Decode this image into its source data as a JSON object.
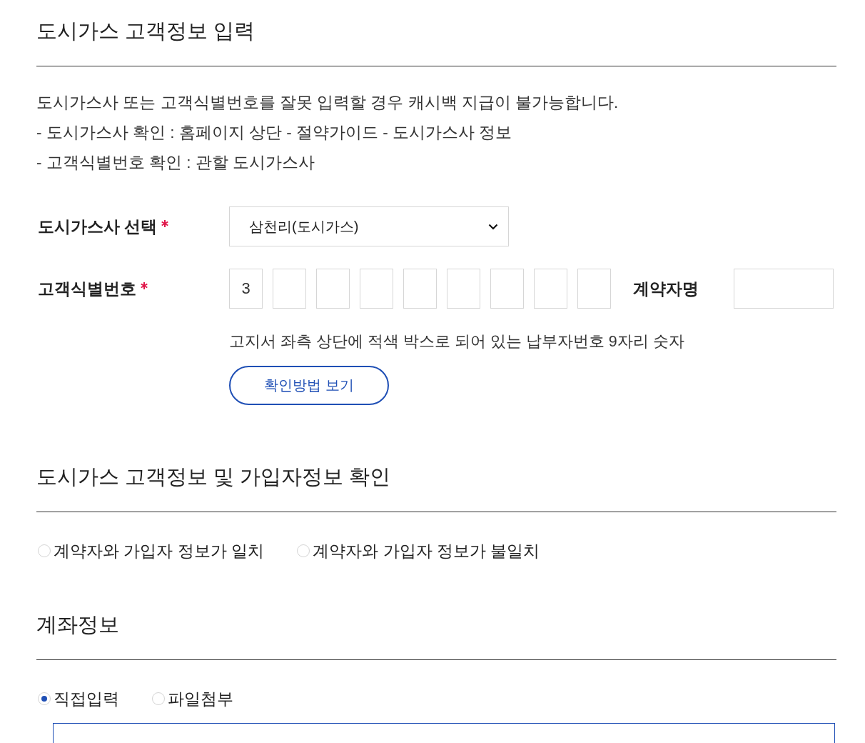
{
  "customer_info": {
    "title": "도시가스 고객정보 입력",
    "notice": [
      "도시가스사 또는 고객식별번호를 잘못 입력할 경우 캐시백 지급이 불가능합니다.",
      "- 도시가스사 확인 : 홈페이지 상단 - 절약가이드 - 도시가스사 정보",
      "- 고객식별번호 확인 : 관할 도시가스사"
    ],
    "company": {
      "label": "도시가스사 선택",
      "required": true,
      "value": "삼천리(도시가스)"
    },
    "customer_number": {
      "label": "고객식별번호",
      "required": true,
      "digits": [
        "3"
      ]
    },
    "contract_name": {
      "label": "계약자명"
    },
    "hint": "고지서 좌측 상단에 적색 박스로 되어 있는 납부자번호 9자리 숫자",
    "help_button": "확인방법 보기"
  },
  "subscriber_check": {
    "title": "도시가스 고객정보 및 가입자정보 확인",
    "options": [
      {
        "label": "계약자와 가입자 정보가 일치",
        "selected": false
      },
      {
        "label": "계약자와 가입자 정보가 불일치",
        "selected": false
      }
    ]
  },
  "account_info": {
    "title": "계좌정보",
    "options": [
      {
        "label": "직접입력",
        "selected": true
      },
      {
        "label": "파일첨부",
        "selected": false
      }
    ]
  }
}
